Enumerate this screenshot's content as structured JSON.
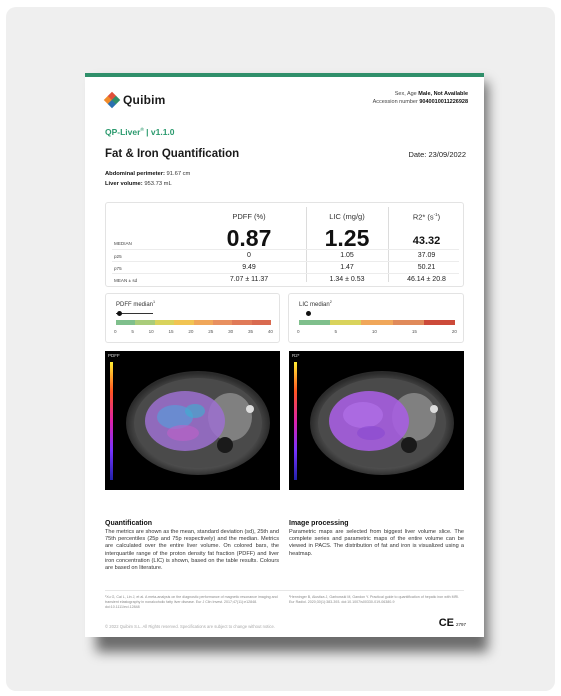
{
  "brand": {
    "name": "Quibim",
    "colors": {
      "accent": "#2f8f6a",
      "product": "#2b9a6e"
    }
  },
  "header": {
    "sex_age_label": "Sex, Age",
    "sex_age_value": "Male, Not Available",
    "accession_label": "Accession number",
    "accession_value": "9040010011226928"
  },
  "product": {
    "name": "QP-Liver",
    "sup": "®",
    "version": "| v1.1.0"
  },
  "report": {
    "title": "Fat & Iron Quantification",
    "date": "Date: 23/09/2022"
  },
  "measurements": {
    "perimeter_label": "Abdominal perimeter:",
    "perimeter_value": "91.67 cm",
    "volume_label": "Liver volume:",
    "volume_value": "953.73 mL"
  },
  "table": {
    "col_pdff": "PDFF (%)",
    "col_lic": "LIC (mg/g)",
    "col_r2": "R2* (s",
    "col_r2_sup": "-1",
    "col_r2_end": ")",
    "rows": {
      "median": {
        "label": "MEDIAN",
        "pdff": "0.87",
        "lic": "1.25",
        "r2": "43.32"
      },
      "p25": {
        "label": "p25",
        "pdff": "0",
        "lic": "1.05",
        "r2": "37.09"
      },
      "p75": {
        "label": "p75",
        "pdff": "9.49",
        "lic": "1.47",
        "r2": "50.21"
      },
      "mean": {
        "label": "MEAN ± sd",
        "pdff": "7.07 ± 11.37",
        "lic": "1.34 ± 0.53",
        "r2": "46.14 ± 20.8"
      }
    }
  },
  "scales": {
    "pdff": {
      "title": "PDFF median",
      "sup": "1",
      "median_value": 0.87,
      "iqr": [
        0,
        9.49
      ],
      "max": 40,
      "ticks": [
        "0",
        "5",
        "10",
        "15",
        "20",
        "25",
        "30",
        "35",
        "40"
      ],
      "colors": [
        "#7fbf8c",
        "#a9cc7a",
        "#d9d35c",
        "#f1c453",
        "#f0a75a",
        "#e89060",
        "#e07a58",
        "#d96a50"
      ]
    },
    "lic": {
      "title": "LIC median",
      "sup": "2",
      "median_value": 1.25,
      "max": 20,
      "ticks": [
        "0",
        "5",
        "10",
        "15",
        "20"
      ],
      "colors": [
        "#7fbf8c",
        "#d9d35c",
        "#f0a75a",
        "#e08a5a",
        "#cc4a3a"
      ]
    }
  },
  "images": {
    "left_label": "PDFF",
    "right_label": "R2*"
  },
  "sections": {
    "quant_title": "Quantification",
    "quant_text": "The metrics are shown as the mean, standard deviation (sd), 25th and 75th percentiles (25p and 75p respectively) and the median. Metrics are calculated over the entire liver volume. On colored bars, the interquartile range of the proton density fat fraction (PDFF) and liver iron concentration (LIC) is shown, based on the table results. Colours are based on literature.",
    "img_title": "Image processing",
    "img_text": "Parametric maps are selected from biggest liver volume slice. The complete series and parametric maps of the entire volume can be viewed in PACS. The distribution of fat and iron is visualized using a heatmap."
  },
  "footer": {
    "ref1": "¹Xu G, Cai L, Lin J, et al. A meta-analysis on the diagnostic performance of magnetic resonance imaging and transient elastography in nonalcoholic fatty liver disease. Eur J Clin Invest. 2017;47(11):e12848. doi:10.1111/eci.12848",
    "ref2": "²Henninger B, Alustiza J, Garbowski M, Gandon Y. Practical guide to quantification of hepatic iron with MRI. Eur Radiol. 2020;30(1):383-393. doi:10.1007/s00330-019-06380-9",
    "copyright": "© 2022 Quibim S.L. All Rights reserved. Specifications are subject to change without notice.",
    "ce_mark": "CE",
    "ce_number": "2797"
  }
}
